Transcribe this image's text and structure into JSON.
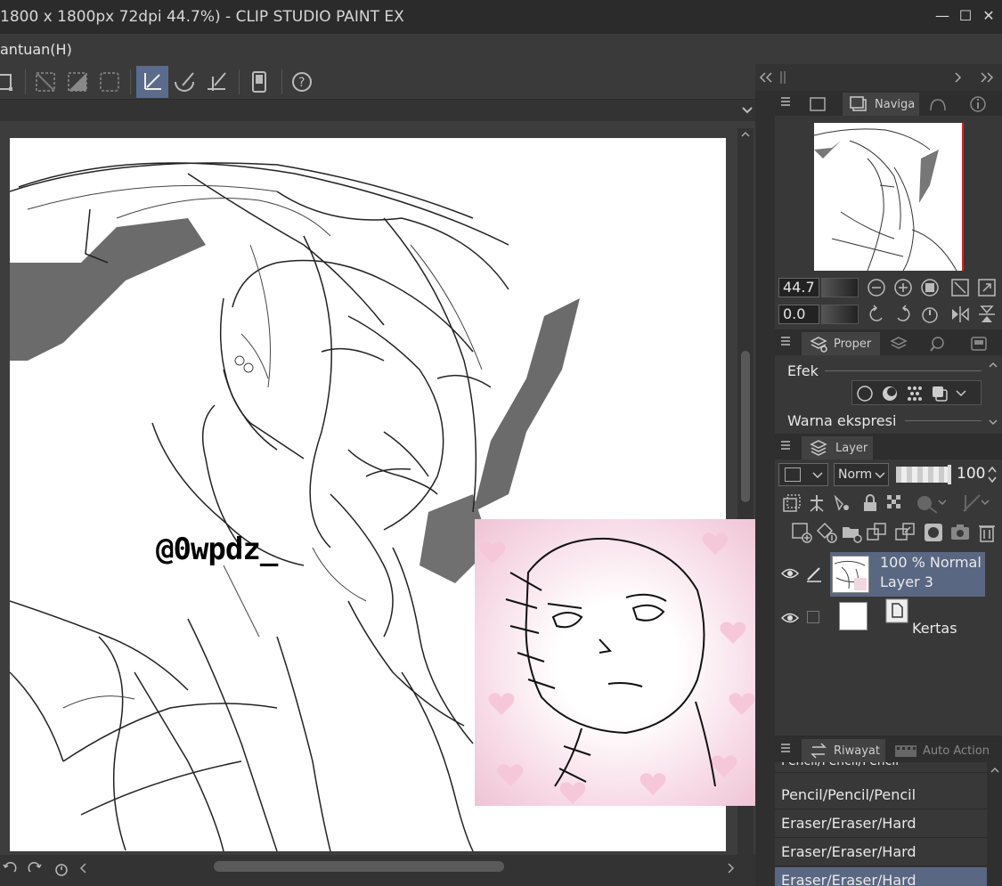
{
  "window": {
    "title": "1800 x 1800px 72dpi 44.7%)  - CLIP STUDIO PAINT EX"
  },
  "menu": {
    "items": [
      "antuan(H)"
    ]
  },
  "canvas": {
    "watermark": "@0wpdz_"
  },
  "panels": {
    "navigator": {
      "tab_label": "Naviga",
      "zoom_value": "44.7",
      "rotate_value": "0.0"
    },
    "properties": {
      "tab_label": "Proper",
      "effect_label": "Efek",
      "expression_label": "Warna ekspresi"
    },
    "layer": {
      "tab_label": "Layer",
      "blend_mode": "Norm",
      "opacity": "100",
      "layers": [
        {
          "meta": "100 % Normal",
          "name": "Layer 3",
          "selected": true
        },
        {
          "meta": "",
          "name": "Kertas",
          "selected": false
        }
      ]
    },
    "history": {
      "tab_label": "Riwayat",
      "tab2_label": "Auto Action",
      "items": [
        "Pencil/Pencil/Pencil",
        "Pencil/Pencil/Pencil",
        "Eraser/Eraser/Hard",
        "Eraser/Eraser/Hard",
        "Eraser/Eraser/Hard"
      ],
      "selected_index": 4
    }
  },
  "colors": {
    "accent": "#5a6b8c",
    "selection": "#5a6782",
    "navigator_frame": "#dd2222"
  }
}
